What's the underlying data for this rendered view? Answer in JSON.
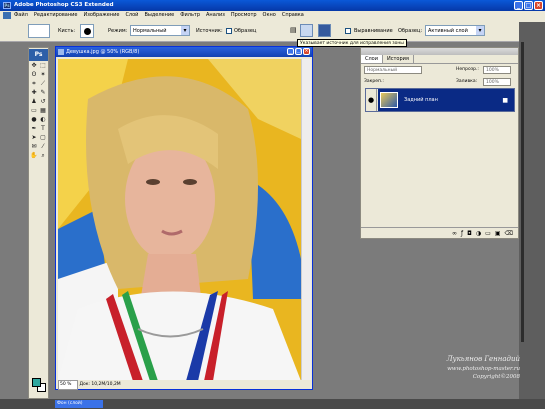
{
  "window": {
    "title": "Adobe Photoshop CS3 Extended",
    "app_icon": "Ps"
  },
  "menu": [
    "Файл",
    "Редактирование",
    "Изображение",
    "Слой",
    "Выделение",
    "Фильтр",
    "Анализ",
    "Просмотр",
    "Окно",
    "Справка"
  ],
  "options": {
    "brush_label": "Кисть:",
    "mode_label": "Режим:",
    "mode_value": "Нормальный",
    "opacity_label": "Источник:",
    "sampled_label": "Образец",
    "aligned_label": "Выравнивание",
    "sample_label": "Образец:",
    "sample_value": "Активный слой",
    "tooltip": "Указывает источник для исправления зоны"
  },
  "document": {
    "title": "Девушка.jpg @ 50% (RGB/8)",
    "zoom": "50 %",
    "status": "Док: 10,2M/10,2M"
  },
  "tools": {
    "logo": "Ps",
    "fg_color": "#2fa8a0",
    "bg_color": "#ffffff"
  },
  "layers": {
    "tabs": [
      "Слои",
      "История"
    ],
    "blend": "Нормальный",
    "opacity_label": "Непрозр.:",
    "opacity_value": "100%",
    "lock_label": "Закреп.:",
    "fill_label": "Заливка:",
    "fill_value": "100%",
    "layer_name": "Задний план"
  },
  "watermark": {
    "name": "Лукьянов Геннадий",
    "site": "www.photoshop-master.ru",
    "copy": "Copyright©2008"
  },
  "taskbar": {
    "item": "Фон (слой)"
  }
}
